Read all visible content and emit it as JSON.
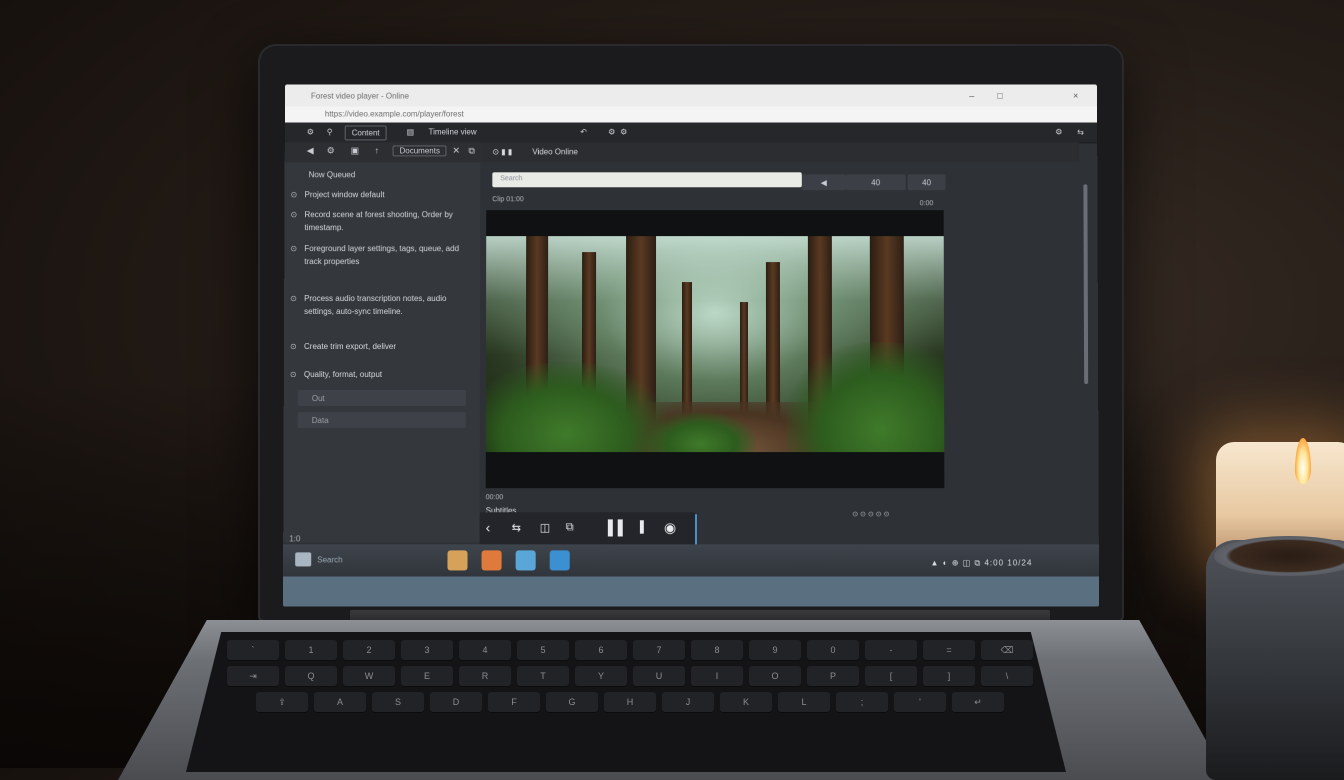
{
  "browser": {
    "tab_title": "Forest video player - Online",
    "address": "https://video.example.com/player/forest",
    "window_controls": [
      "–",
      "□",
      "×"
    ]
  },
  "toolbar": {
    "buttons": [
      "⚙",
      "⚲",
      "Content",
      "▤",
      "Timeline view",
      "↶",
      "⚙",
      "⚙"
    ],
    "right_icons": [
      "⚙",
      "⇆"
    ]
  },
  "left_panel": {
    "tools": [
      "◀",
      "⚙",
      "▣",
      "↑",
      "Documents",
      "✕",
      "⧉"
    ],
    "title": "Now Queued",
    "items": [
      "Project window default",
      "Record scene at forest shooting, Order by timestamp.",
      "Foreground layer settings, tags, queue, add track properties",
      "Process audio transcription notes, audio settings, auto-sync timeline.",
      "Create trim export, deliver",
      "Quality, format, output"
    ],
    "fields": [
      "Out",
      "Data"
    ],
    "footer": "1:0"
  },
  "main": {
    "tab_label": "Video Online",
    "search_placeholder": "Search",
    "segments": [
      "◀",
      "40",
      "40"
    ],
    "meta_top": "Clip 01:00",
    "meta_top_right": "0:00",
    "meta_bottom": "00:00",
    "caption_label": "Subtitles",
    "controls": [
      "‹",
      "⇆",
      "◫",
      "⧉",
      "▌▌",
      "▌",
      "◉"
    ],
    "right_indicators": "⊙   ⊙   ⊙ ⊙ ⊙"
  },
  "taskbar": {
    "label": "Search",
    "apps": [
      {
        "name": "files",
        "color": "#d6a25a"
      },
      {
        "name": "browser",
        "color": "#e07a3c"
      },
      {
        "name": "photos",
        "color": "#5aa6d8"
      },
      {
        "name": "store",
        "color": "#3c8fd0"
      }
    ],
    "tray": "▲ ◐ ⊕ ◫ ⧉ 4:00 10/24"
  },
  "keyboard_rows": [
    [
      "`",
      "1",
      "2",
      "3",
      "4",
      "5",
      "6",
      "7",
      "8",
      "9",
      "0",
      "-",
      "=",
      "⌫"
    ],
    [
      "⇥",
      "Q",
      "W",
      "E",
      "R",
      "T",
      "Y",
      "U",
      "I",
      "O",
      "P",
      "[",
      "]",
      "\\"
    ],
    [
      "⇪",
      "A",
      "S",
      "D",
      "F",
      "G",
      "H",
      "J",
      "K",
      "L",
      ";",
      "'",
      "↵"
    ]
  ]
}
